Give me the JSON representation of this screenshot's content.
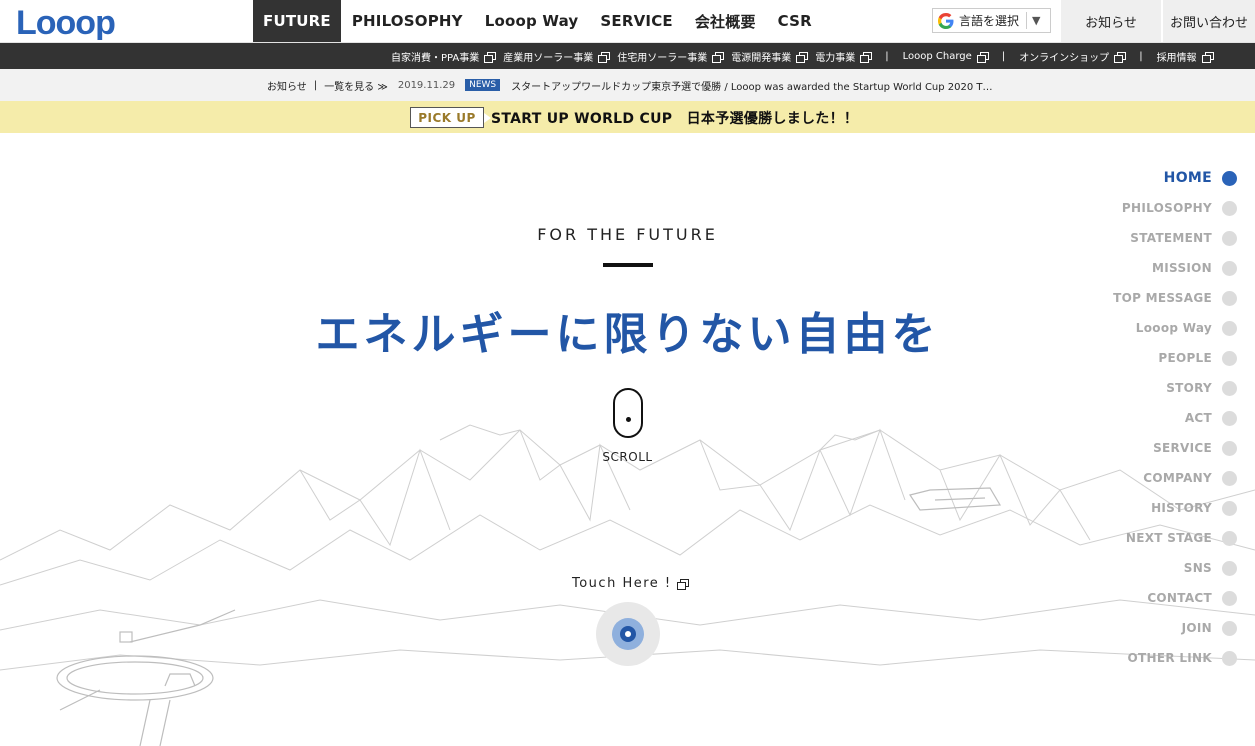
{
  "brand": {
    "logo_text": "Looop",
    "color": "#2a63b8"
  },
  "main_nav": [
    {
      "label": "FUTURE",
      "active": true
    },
    {
      "label": "PHILOSOPHY",
      "active": false
    },
    {
      "label": "Looop Way",
      "active": false
    },
    {
      "label": "SERVICE",
      "active": false
    },
    {
      "label": "会社概要",
      "active": false
    },
    {
      "label": "CSR",
      "active": false
    }
  ],
  "language_select": {
    "label": "言語を選択",
    "icon": "google-g-icon",
    "arrow": "▼"
  },
  "top_buttons": {
    "news": "お知らせ",
    "contact": "お問い合わせ"
  },
  "sub_nav": {
    "items": [
      "自家消費・PPA事業",
      "産業用ソーラー事業",
      "住宅用ソーラー事業",
      "電源開発事業",
      "電力事業",
      "Looop Charge",
      "オンラインショップ",
      "採用情報"
    ],
    "separator": "|"
  },
  "news_bar": {
    "label": "お知らせ",
    "separator": "|",
    "list_link": "一覧を見る ≫",
    "date": "2019.11.29",
    "tag": "NEWS",
    "headline": "スタートアップワールドカップ東京予選で優勝 / Looop was awarded the Startup World Cup 2020 T…"
  },
  "pickup": {
    "button": "PICK UP",
    "text": "START UP WORLD CUP　日本予選優勝しました！！"
  },
  "hero": {
    "eyebrow": "FOR THE FUTURE",
    "headline": "エネルギーに限りない自由を",
    "scroll_label": "SCROLL",
    "touch_label": "Touch Here !"
  },
  "side_nav": [
    {
      "label": "HOME",
      "active": true
    },
    {
      "label": "PHILOSOPHY",
      "active": false
    },
    {
      "label": "STATEMENT",
      "active": false
    },
    {
      "label": "MISSION",
      "active": false
    },
    {
      "label": "TOP MESSAGE",
      "active": false
    },
    {
      "label": "Looop Way",
      "active": false
    },
    {
      "label": "PEOPLE",
      "active": false
    },
    {
      "label": "STORY",
      "active": false
    },
    {
      "label": "ACT",
      "active": false
    },
    {
      "label": "SERVICE",
      "active": false
    },
    {
      "label": "COMPANY",
      "active": false
    },
    {
      "label": "HISTORY",
      "active": false
    },
    {
      "label": "NEXT STAGE",
      "active": false
    },
    {
      "label": "SNS",
      "active": false
    },
    {
      "label": "CONTACT",
      "active": false
    },
    {
      "label": "JOIN",
      "active": false
    },
    {
      "label": "OTHER LINK",
      "active": false
    }
  ],
  "colors": {
    "accent": "#2256a6",
    "pickup_bg": "#f5ecaa",
    "subnav_bg": "#333333"
  }
}
